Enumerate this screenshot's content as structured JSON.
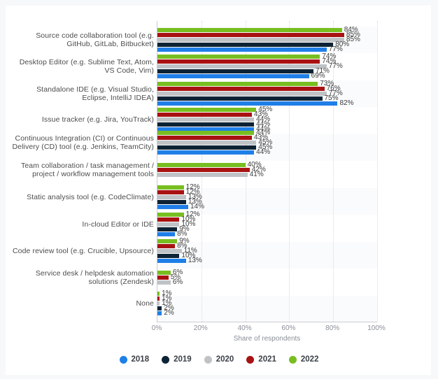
{
  "chart_data": {
    "type": "bar",
    "orientation": "horizontal",
    "title": "",
    "xlabel": "Share of respondents",
    "ylabel": "",
    "xlim": [
      0,
      100
    ],
    "xticks": [
      "0%",
      "20%",
      "40%",
      "60%",
      "80%",
      "100%"
    ],
    "xtick_values": [
      0,
      20,
      40,
      60,
      80,
      100
    ],
    "grid": true,
    "legend_position": "bottom",
    "categories": [
      "Source code collaboration tool (e.g. GitHub, GitLab, Bitbucket)",
      "Desktop Editor (e.g. Sublime Text, Atom, VS Code, Vim)",
      "Standalone IDE (e.g. Visual Studio, Eclipse, IntelliJ IDEA)",
      "Issue tracker (e.g. Jira, YouTrack)",
      "Continuous Integration (CI) or Continuous Delivery (CD) tool (e.g. Jenkins, TeamCity)",
      "Team collaboration / task management / project / workflow management tools",
      "Static analysis tool (e.g. CodeClimate)",
      "In-cloud Editor or IDE",
      "Code review tool (e.g. Crucible, Upsource)",
      "Service desk / helpdesk automation solutions (Zendesk)",
      "None"
    ],
    "series": [
      {
        "name": "2022",
        "color": "#78be20",
        "values": [
          84,
          74,
          73,
          45,
          44,
          40,
          12,
          12,
          9,
          6,
          1
        ],
        "labels": [
          "84%",
          "74%",
          "73%",
          "45%",
          "44%",
          "40%",
          "12%",
          "12%",
          "9%",
          "6%",
          "1%"
        ]
      },
      {
        "name": "2021",
        "color": "#a81212",
        "values": [
          85,
          74,
          76,
          43,
          43,
          42,
          12,
          10,
          8,
          5,
          1
        ],
        "labels": [
          "85%",
          "74%",
          "76%",
          "43%",
          "43%",
          "42%",
          "12%",
          "10%",
          "8%",
          "5%",
          "1%"
        ]
      },
      {
        "name": "2020",
        "color": "#bfc2c6",
        "values": [
          85,
          77,
          77,
          44,
          45,
          41,
          13,
          10,
          11,
          6,
          1
        ],
        "labels": [
          "85%",
          "77%",
          "77%",
          "44%",
          "45%",
          "41%",
          "13%",
          "10%",
          "11%",
          "6%",
          "1%"
        ]
      },
      {
        "name": "2019",
        "color": "#0d2335",
        "values": [
          80,
          71,
          75,
          44,
          45,
          null,
          13,
          9,
          10,
          null,
          2
        ],
        "labels": [
          "80%",
          "71%",
          "75%",
          "44%",
          "45%",
          "",
          "13%",
          "9%",
          "10%",
          "",
          "2%"
        ]
      },
      {
        "name": "2018",
        "color": "#1f7fe8",
        "values": [
          77,
          69,
          82,
          44,
          44,
          null,
          14,
          8,
          13,
          null,
          2
        ],
        "labels": [
          "77%",
          "69%",
          "82%",
          "44%",
          "44%",
          "",
          "14%",
          "8%",
          "13%",
          "",
          "2%"
        ]
      }
    ]
  },
  "legend": {
    "items": [
      {
        "label": "2018",
        "color": "#1f7fe8"
      },
      {
        "label": "2019",
        "color": "#0d2335"
      },
      {
        "label": "2020",
        "color": "#bfc2c6"
      },
      {
        "label": "2021",
        "color": "#a81212"
      },
      {
        "label": "2022",
        "color": "#78be20"
      }
    ]
  }
}
